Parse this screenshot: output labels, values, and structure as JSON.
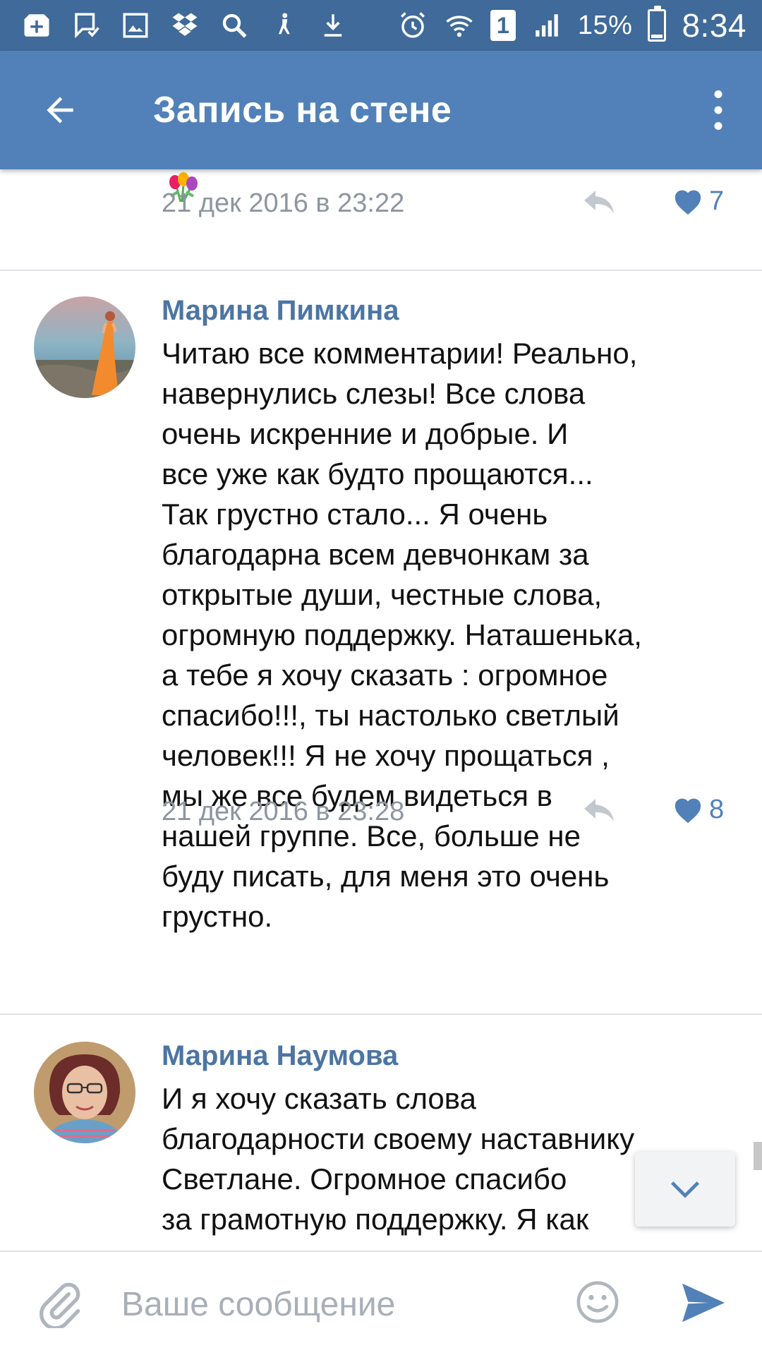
{
  "status_bar": {
    "battery_percent": "15%",
    "time": "8:34",
    "sim_label": "1",
    "battery_level": 0.15,
    "icons_left": [
      "add-box-icon",
      "message-check-icon",
      "image-icon",
      "dropbox-icon",
      "search-icon",
      "accessibility-icon",
      "download-icon"
    ],
    "icons_right": [
      "alarm-icon",
      "wifi-icon",
      "sim-icon",
      "signal-icon",
      "battery-icon"
    ]
  },
  "app_bar": {
    "title": "Запись на стене",
    "back_icon": "arrow-left-icon",
    "menu_icon": "more-vertical-icon"
  },
  "previous_comment": {
    "emoji": "flowers-emoji",
    "date": "21 дек 2016 в 23:22",
    "likes": "7"
  },
  "comments": [
    {
      "author": "Марина Пимкина",
      "text": "Читаю все комментарии! Реально,\nнавернулись слезы! Все слова\nочень искренние и добрые. И\nвсе уже как будто прощаются...\nТак грустно стало... Я очень\nблагодарна всем девчонкам за\nоткрытые души, честные слова,\nогромную поддержку. Наташенька,\nа тебе я хочу сказать : огромное\nспасибо!!!, ты настолько светлый\nчеловек!!! Я не хочу прощаться ,\nмы же все будем видеться в\nнашей группе. Все, больше не\nбуду писать, для меня это очень\nгрустно.",
      "date": "21 дек 2016 в 23:28",
      "likes": "8"
    },
    {
      "author": "Марина Наумова",
      "text": "И я хочу сказать слова\nблагодарности своему наставнику\nСветлане. Огромное спасибо\nза грамотную поддержку. Я как"
    }
  ],
  "composer": {
    "placeholder": "Ваше сообщение"
  },
  "colors": {
    "status_bar": "#3f6a99",
    "app_bar": "#5181b8",
    "author": "#4c75a3",
    "meta": "#8d95a0",
    "like": "#5181b8",
    "divider": "#dfe2e6"
  }
}
